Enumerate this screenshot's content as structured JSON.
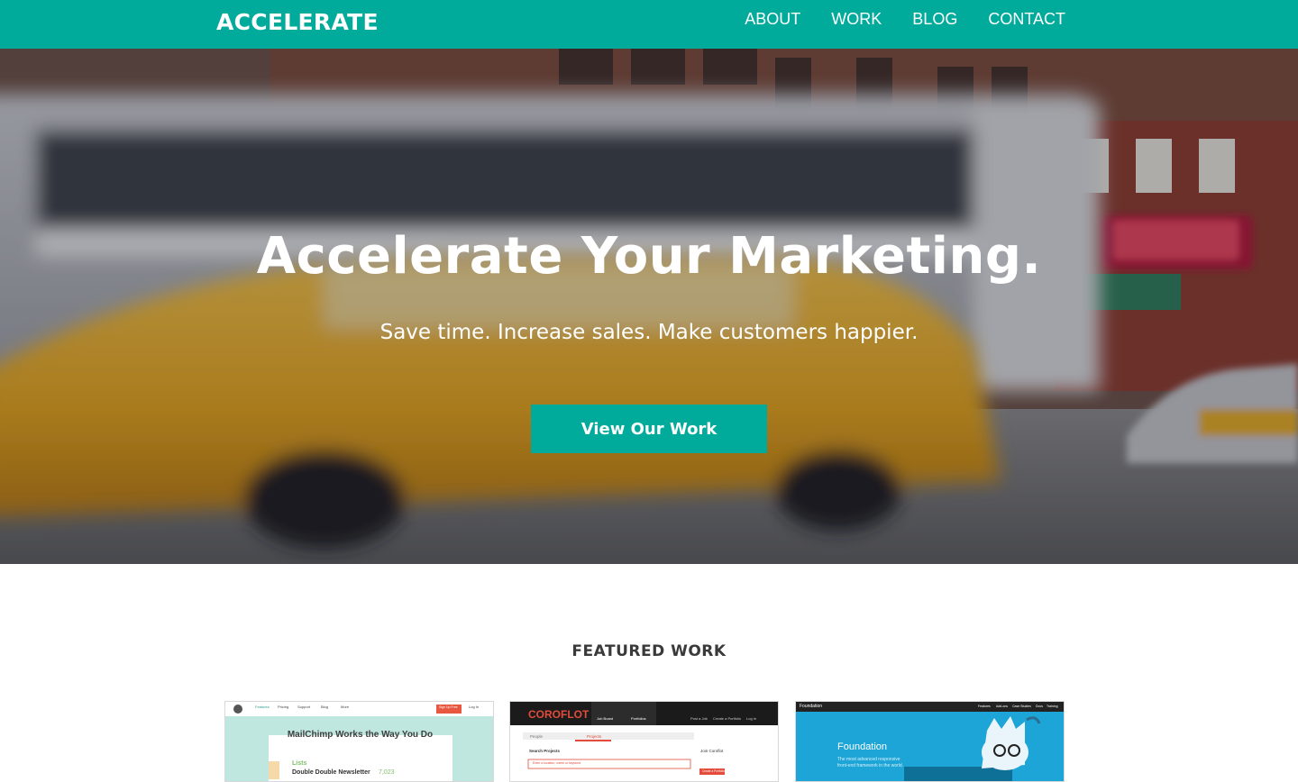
{
  "header": {
    "logo": "ACCELERATE",
    "nav": [
      "ABOUT",
      "WORK",
      "BLOG",
      "CONTACT"
    ]
  },
  "hero": {
    "title": "Accelerate Your Marketing.",
    "subtitle": "Save time. Increase sales. Make customers happier.",
    "cta": "View Our Work"
  },
  "featured": {
    "title": "FEATURED WORK",
    "items": [
      {
        "headline": "MailChimp Works the Way You Do",
        "list_label": "Lists",
        "list_item": "Double Double Newsletter",
        "list_count": "7,023",
        "cta": "Sign Up Free",
        "login": "Log In",
        "nav": [
          "Features",
          "Pricing",
          "Support",
          "Blog",
          "More"
        ]
      },
      {
        "brand": "COROFLOT",
        "nav": [
          "Job Board",
          "Portfolios",
          "Post a Job",
          "Create a Portfolio",
          "Log In"
        ],
        "tabs": [
          "People",
          "Projects"
        ],
        "search_label": "Search Projects",
        "search_placeholder": "Enter a location, name or keyword",
        "join_title": "Join Coroflot",
        "join_button": "Create a Portfolio"
      },
      {
        "brand": "Foundation",
        "nav": [
          "Features",
          "Add-ons",
          "Case Studies",
          "Docs",
          "Training"
        ],
        "headline": "Foundation",
        "tagline_1": "The most advanced responsive",
        "tagline_2": "front-end framework in the world."
      }
    ]
  },
  "colors": {
    "brand": "#00ab9c",
    "text_dark": "#3a3a3a",
    "white": "#ffffff"
  }
}
